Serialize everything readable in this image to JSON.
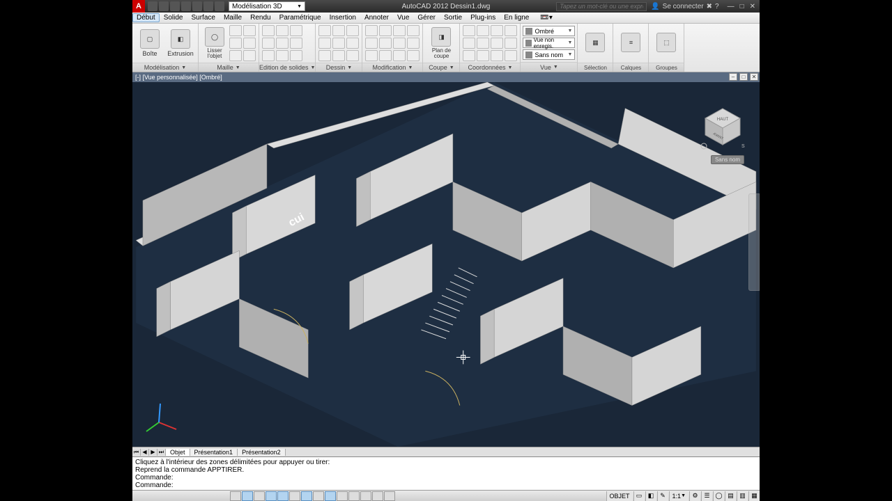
{
  "app": {
    "logo_letter": "A",
    "title": "AutoCAD 2012   Dessin1.dwg",
    "workspace": "Modélisation 3D",
    "search_placeholder": "Tapez un mot-clé ou une expression",
    "signin": "Se connecter",
    "win": {
      "min": "—",
      "max": "□",
      "close": "✕"
    }
  },
  "menu": {
    "items": [
      "Début",
      "Solide",
      "Surface",
      "Maille",
      "Rendu",
      "Paramétrique",
      "Insertion",
      "Annoter",
      "Vue",
      "Gérer",
      "Sortie",
      "Plug-ins",
      "En ligne"
    ],
    "active_index": 0
  },
  "ribbon": {
    "modelisation": {
      "label": "Modélisation",
      "boite": "Boîte",
      "extrusion": "Extrusion"
    },
    "maille": {
      "label": "Maille",
      "lisser": "Lisser l'objet"
    },
    "edition": {
      "label": "Edition de solides"
    },
    "dessin": {
      "label": "Dessin"
    },
    "modification": {
      "label": "Modification"
    },
    "coupe": {
      "label": "Coupe",
      "plan": "Plan de coupe"
    },
    "coord": {
      "label": "Coordonnées"
    },
    "vue": {
      "label": "Vue",
      "style1": "Ombré",
      "style2": "Vue non enregis.",
      "style3": "Sans nom"
    },
    "selection": {
      "label": "Sélection"
    },
    "calques": {
      "label": "Calques"
    },
    "groupes": {
      "label": "Groupes"
    }
  },
  "viewport": {
    "header": "[-] [Vue personnalisée] [Ombré]",
    "text_label": "cui",
    "viewcube_btn": "Sans nom",
    "win": {
      "min": "–",
      "max": "□",
      "close": "✕"
    }
  },
  "tabs": {
    "nav": [
      "⏮",
      "◀",
      "▶",
      "⏭"
    ],
    "items": [
      "Objet",
      "Présentation1",
      "Présentation2"
    ],
    "active_index": 0
  },
  "cmd": {
    "l1": "Cliquez à l'intérieur des zones délimitées pour appuyer ou tirer:",
    "l2": "Reprend la commande APPTIRER.",
    "l3": "Commande:",
    "l4": "Commande:"
  },
  "status": {
    "objet": "OBJET",
    "scale": "1:1",
    "zoom": "▼"
  }
}
